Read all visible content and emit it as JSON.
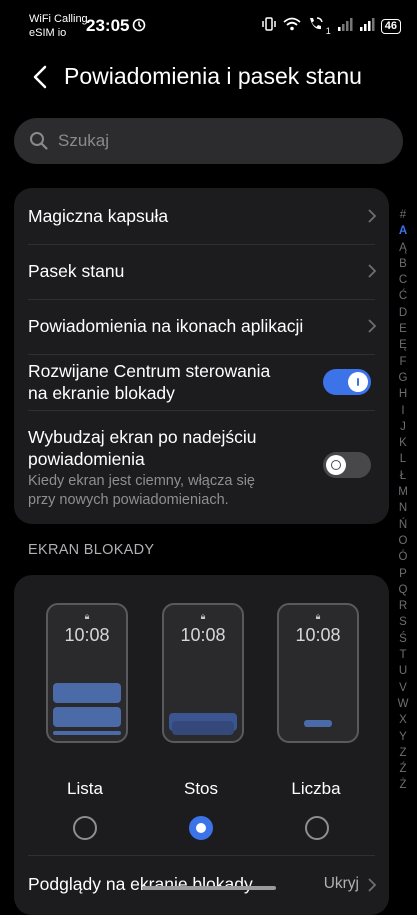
{
  "status_bar": {
    "carrier_line1": "WiFi Calling",
    "carrier_line2": "eSIM io",
    "time": "23:05",
    "wifi_call_sub": "1",
    "battery": "46"
  },
  "header": {
    "title": "Powiadomienia i pasek stanu"
  },
  "search": {
    "placeholder": "Szukaj"
  },
  "settings": [
    {
      "label": "Magiczna kapsuła",
      "type": "chevron"
    },
    {
      "label": "Pasek stanu",
      "type": "chevron"
    },
    {
      "label": "Powiadomienia na ikonach aplikacji",
      "type": "chevron"
    },
    {
      "label_line1": "Rozwijane Centrum sterowania",
      "label_line2": "na ekranie blokady",
      "type": "toggle",
      "on": true
    },
    {
      "label_line1": "Wybudzaj ekran po nadejściu",
      "label_line2": "powiadomienia",
      "sub_line1": "Kiedy ekran jest ciemny, włącza się",
      "sub_line2": "przy nowych powiadomieniach.",
      "type": "toggle",
      "on": false
    }
  ],
  "lock_screen": {
    "section_title": "EKRAN BLOKADY",
    "options": [
      {
        "time": "10:08",
        "label": "Lista",
        "selected": false
      },
      {
        "time": "10:08",
        "label": "Stos",
        "selected": true
      },
      {
        "time": "10:08",
        "label": "Liczba",
        "selected": false
      }
    ],
    "previews_label": "Podglądy na ekranie blokady",
    "previews_value": "Ukryj"
  },
  "alphabet_index": [
    "#",
    "A",
    "Ą",
    "B",
    "C",
    "Ć",
    "D",
    "E",
    "Ę",
    "F",
    "G",
    "H",
    "I",
    "J",
    "K",
    "L",
    "Ł",
    "M",
    "N",
    "Ń",
    "O",
    "Ó",
    "P",
    "Q",
    "R",
    "S",
    "Ś",
    "T",
    "U",
    "V",
    "W",
    "X",
    "Y",
    "Z",
    "Ź",
    "Ż"
  ],
  "alphabet_active": "A",
  "colors": {
    "accent": "#3d73e8",
    "card": "#1c1c1e",
    "background": "#000000"
  }
}
